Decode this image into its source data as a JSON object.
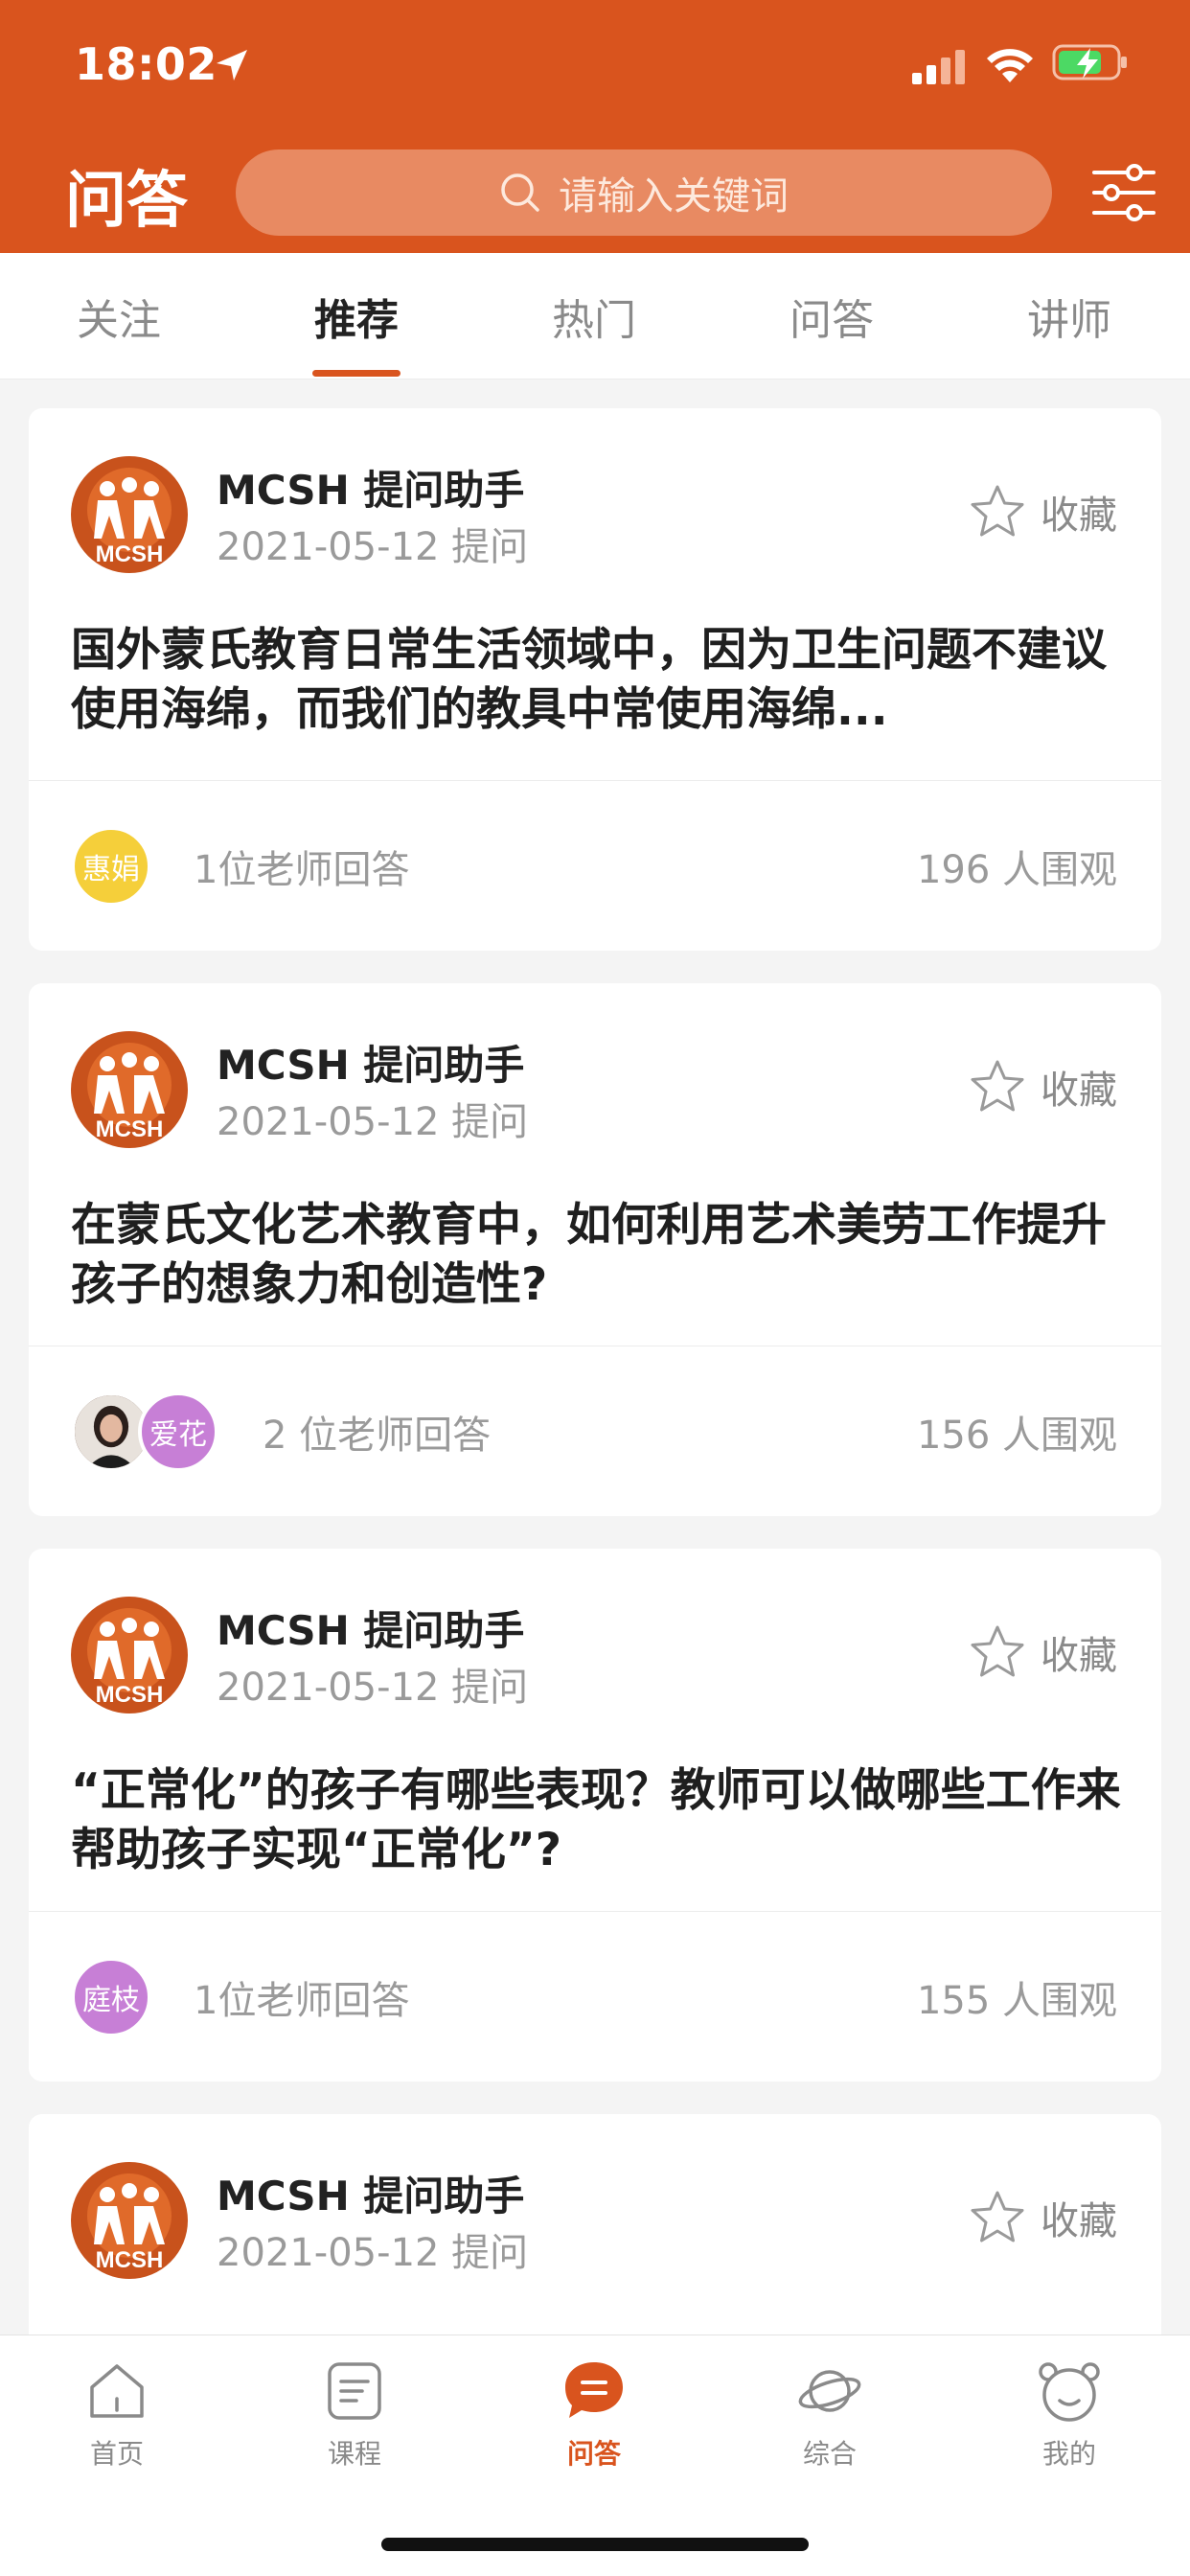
{
  "status_bar": {
    "time": "18:02"
  },
  "header": {
    "title": "问答",
    "search_placeholder": "请输入关键词",
    "accent_color": "#d9541e"
  },
  "tabs": [
    {
      "label": "关注",
      "active": false
    },
    {
      "label": "推荐",
      "active": true
    },
    {
      "label": "热门",
      "active": false
    },
    {
      "label": "问答",
      "active": false
    },
    {
      "label": "讲师",
      "active": false
    }
  ],
  "posts": [
    {
      "author": "MCSH 提问助手",
      "date": "2021-05-12 提问",
      "favorite_label": "收藏",
      "question": "国外蒙氏教育日常生活领域中，因为卫生问题不建议使用海绵，而我们的教具中常使用海绵...",
      "teachers": [
        {
          "name": "惠娟",
          "color": "#f5cf3a"
        }
      ],
      "answers": "1位老师回答",
      "views": "196 人围观"
    },
    {
      "author": "MCSH 提问助手",
      "date": "2021-05-12 提问",
      "favorite_label": "收藏",
      "question": "在蒙氏文化艺术教育中，如何利用艺术美劳工作提升孩子的想象力和创造性?",
      "teachers": [
        {
          "name": "",
          "color": "#6b4a3a"
        },
        {
          "name": "爱花",
          "color": "#c77fd6"
        }
      ],
      "answers": "2 位老师回答",
      "views": "156 人围观"
    },
    {
      "author": "MCSH 提问助手",
      "date": "2021-05-12 提问",
      "favorite_label": "收藏",
      "question": "“正常化”的孩子有哪些表现？教师可以做哪些工作来帮助孩子实现“正常化”?",
      "teachers": [
        {
          "name": "庭枝",
          "color": "#c77fd6"
        }
      ],
      "answers": "1位老师回答",
      "views": "155 人围观"
    },
    {
      "author": "MCSH 提问助手",
      "date": "2021-05-12 提问",
      "favorite_label": "收藏"
    }
  ],
  "bottom_nav": [
    {
      "label": "首页",
      "icon": "home-icon",
      "active": false
    },
    {
      "label": "课程",
      "icon": "course-icon",
      "active": false
    },
    {
      "label": "问答",
      "icon": "qa-icon",
      "active": true
    },
    {
      "label": "综合",
      "icon": "planet-icon",
      "active": false
    },
    {
      "label": "我的",
      "icon": "profile-icon",
      "active": false
    }
  ]
}
